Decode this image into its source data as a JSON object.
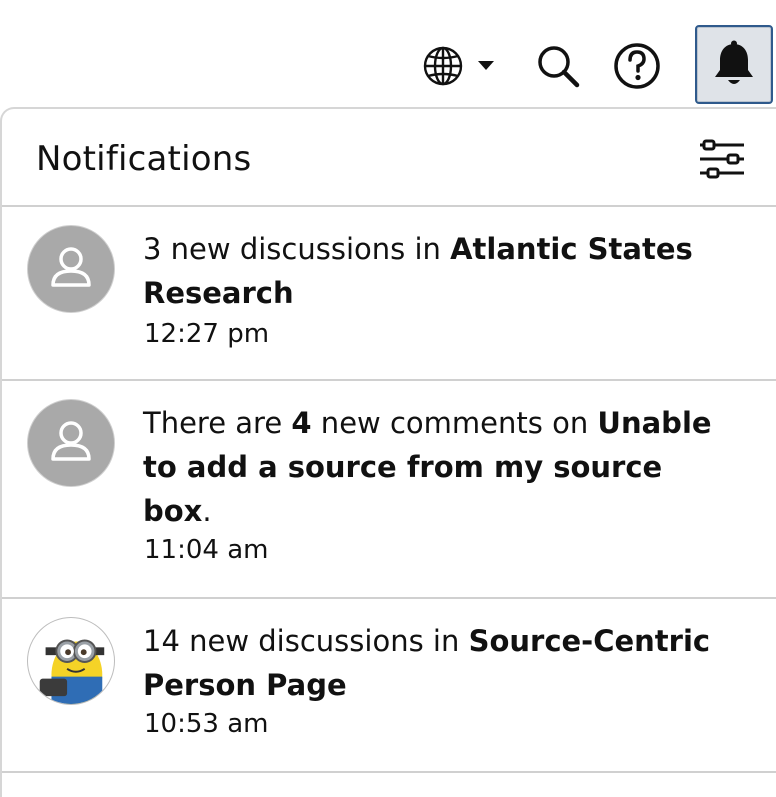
{
  "header": {
    "icons": {
      "language": "globe-icon",
      "language_dropdown": "caret-down-icon",
      "search": "search-icon",
      "help": "help-circle-icon",
      "notifications": "bell-icon"
    }
  },
  "notifications_panel": {
    "title": "Notifications",
    "settings_icon": "sliders-icon",
    "items": [
      {
        "avatar": "default-user-avatar",
        "parts": [
          "3 new discussions in ",
          "Atlantic States Research"
        ],
        "time": "12:27 pm"
      },
      {
        "avatar": "default-user-avatar",
        "parts": [
          "There are ",
          "4",
          " new comments on ",
          "Unable to add a source from my source box",
          "."
        ],
        "time": "11:04 am"
      },
      {
        "avatar": "minion-avatar",
        "parts": [
          "14 new discussions in ",
          "Source-Centric Person Page"
        ],
        "time": "10:53 am"
      }
    ]
  },
  "colors": {
    "bell_button_bg": "#dfe3e8",
    "bell_button_border": "#2f5a8c",
    "avatar_gray": "#a9a9a9",
    "divider": "#d0d0d0"
  }
}
